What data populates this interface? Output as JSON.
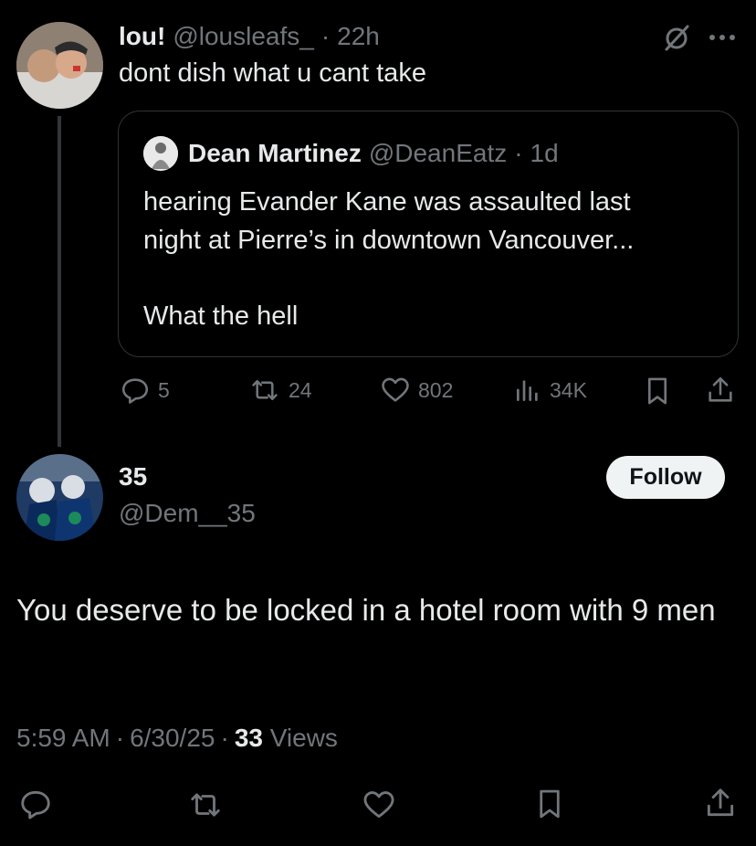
{
  "reply_tweet": {
    "name": "lou!",
    "handle": "@lousleafs_",
    "separator": "·",
    "time": "22h",
    "text": "dont dish what u cant take",
    "icons": {
      "grok": "slashed-circle-icon",
      "more": "more-dots-icon"
    },
    "quote": {
      "name": "Dean Martinez",
      "handle": "@DeanEatz",
      "separator": "·",
      "time": "1d",
      "line1": "hearing Evander Kane was assaulted last",
      "line2": "night at Pierre’s in downtown Vancouver...",
      "line3": "What the hell"
    },
    "actions": {
      "replies": "5",
      "reposts": "24",
      "likes": "802",
      "views": "34K"
    }
  },
  "main_tweet": {
    "name": "35",
    "handle": "@Dem__35",
    "follow_label": "Follow",
    "text": "You deserve to be locked in a hotel room with 9 men",
    "time": "5:59 AM",
    "sep1": "·",
    "date": "6/30/25",
    "sep2": "·",
    "views_count": "33",
    "views_label": "Views"
  },
  "colors": {
    "background": "#000000",
    "text": "#e7e9ea",
    "muted": "#71767b",
    "border": "#2f3336",
    "follow_bg": "#eff3f4"
  }
}
